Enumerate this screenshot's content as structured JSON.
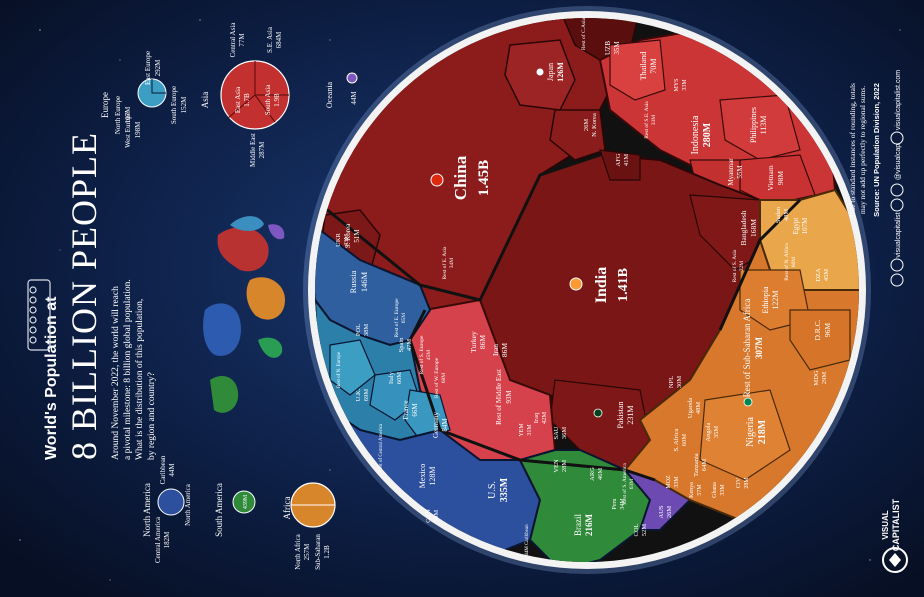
{
  "title": {
    "line1": "World's Population at",
    "line2": "8 BILLION PEOPLE",
    "intro1": "Around November 2022, the world will reach",
    "intro2": "a pivotal milestone: 8 billion global population.",
    "intro3": "What is the distribution of this population,",
    "intro4": "by region and country?"
  },
  "footer": {
    "note1": "Due to standard instances of rounding, totals",
    "note2": "may not add up perfectly to regional sums.",
    "source": "Source: UN Population Division, 2022",
    "brand1": "VISUAL",
    "brand2": "CAPITALIST",
    "social1": "visualcapitalist",
    "social2": "@visualcap",
    "social3": "visualcapitalist.com"
  },
  "legend": {
    "europe": {
      "label": "Europe",
      "north": "North Europe",
      "north_v": "107M",
      "east": "East Europe",
      "east_v": "292M",
      "west": "West Europe",
      "west_v": "198M",
      "south": "South Europe",
      "south_v": "152M"
    },
    "asia": {
      "label": "Asia",
      "central": "Central Asia",
      "central_v": "77M",
      "se": "S.E. Asia",
      "se_v": "684M",
      "east": "East Asia",
      "east_v": "1.7B",
      "south": "South Asia",
      "south_v": "1.9B",
      "middle": "Middle East",
      "middle_v": "287M"
    },
    "oceania": {
      "label": "Oceania",
      "value": "44M"
    },
    "namerica": {
      "label": "North America",
      "central": "Central America",
      "central_v": "182M",
      "carib": "Caribbean",
      "carib_v": "44M",
      "north": "North America",
      "north_v": "377M"
    },
    "samerica": {
      "label": "South America",
      "value": "439M"
    },
    "africa": {
      "label": "Africa",
      "north": "North Africa",
      "north_v": "257M",
      "sub": "Sub-Saharan",
      "sub_v": "1.2B"
    }
  },
  "cells": {
    "china": {
      "name": "China",
      "value": "1.45B"
    },
    "india": {
      "name": "India",
      "value": "1.41B"
    },
    "japan": {
      "name": "Japan",
      "value": "126M"
    },
    "skorea": {
      "name": "S. Korea",
      "value": "51M"
    },
    "nkorea": {
      "name": "N. Korea",
      "value": "26M"
    },
    "resteasia": {
      "name": "Rest of E. Asia",
      "value": "34M"
    },
    "uzb": {
      "name": "UZB",
      "value": "35M"
    },
    "restcasia": {
      "name": "Rest of C.Asia",
      "value": ""
    },
    "thailand": {
      "name": "Thailand",
      "value": "70M"
    },
    "mys": {
      "name": "MYS",
      "value": "33M"
    },
    "restseasia": {
      "name": "Rest of S.E. Asia",
      "value": "33M"
    },
    "indonesia": {
      "name": "Indonesia",
      "value": "280M"
    },
    "philippines": {
      "name": "Philippines",
      "value": "113M"
    },
    "myanmar": {
      "name": "Myanmar",
      "value": "55M"
    },
    "vietnam": {
      "name": "Vietnam",
      "value": "98M"
    },
    "afg": {
      "name": "AFG",
      "value": "41M"
    },
    "bangladesh": {
      "name": "Bangladesh",
      "value": "168M"
    },
    "restsasia": {
      "name": "Rest of S. Asia",
      "value": "22M"
    },
    "pakistan": {
      "name": "Pakistan",
      "value": "231M"
    },
    "npl": {
      "name": "NPL",
      "value": "30M"
    },
    "turkey": {
      "name": "Turkey",
      "value": "86M"
    },
    "iran": {
      "name": "Iran",
      "value": "86M"
    },
    "restme": {
      "name": "Rest of Middle East",
      "value": "93M"
    },
    "iraq": {
      "name": "Iraq",
      "value": "42M"
    },
    "sau": {
      "name": "SAU",
      "value": "36M"
    },
    "yem": {
      "name": "YEM",
      "value": "31M"
    },
    "russia": {
      "name": "Russia",
      "value": "146M"
    },
    "ukr": {
      "name": "UKR",
      "value": "43M"
    },
    "pol": {
      "name": "POL",
      "value": "38M"
    },
    "resteeurope": {
      "name": "Rest of E. Europe",
      "value": "65M"
    },
    "spain": {
      "name": "Spain",
      "value": "47M"
    },
    "restseurope": {
      "name": "Rest of S. Europe",
      "value": "45M"
    },
    "italy": {
      "name": "Italy",
      "value": "60M"
    },
    "uk": {
      "name": "U.K.",
      "value": "69M"
    },
    "restneurope": {
      "name": "Rest of N. Europe",
      "value": ""
    },
    "restweurope": {
      "name": "Rest of W. Europe",
      "value": "68M"
    },
    "france": {
      "name": "France",
      "value": "66M"
    },
    "germany": {
      "name": "Germany",
      "value": "84M"
    },
    "egypt": {
      "name": "Egypt",
      "value": "107M"
    },
    "sudan": {
      "name": "Sudan",
      "value": "48M"
    },
    "restnafrica": {
      "name": "Rest of N. Africa",
      "value": "60M"
    },
    "dza": {
      "name": "DZA",
      "value": "45M"
    },
    "ethiopia": {
      "name": "Ethiopia",
      "value": "122M"
    },
    "drc": {
      "name": "D.R.C.",
      "value": "96M"
    },
    "restssa": {
      "name": "Rest of Sub-Saharan Africa",
      "value": "307M"
    },
    "nigeria": {
      "name": "Nigeria",
      "value": "218M"
    },
    "moz": {
      "name": "MOZ",
      "value": "33M"
    },
    "uganda": {
      "name": "Uganda",
      "value": "48M"
    },
    "angola": {
      "name": "Angola",
      "value": "35M"
    },
    "safrica": {
      "name": "S. Africa",
      "value": "60M"
    },
    "tanzania": {
      "name": "Tanzania",
      "value": "64M"
    },
    "kenya": {
      "name": "Kenya",
      "value": "57M"
    },
    "ghana": {
      "name": "Ghana",
      "value": "33M"
    },
    "civ": {
      "name": "CIV",
      "value": "28M"
    },
    "mdg": {
      "name": "MDG",
      "value": "29M"
    },
    "aus": {
      "name": "AUS",
      "value": "26M"
    },
    "brazil": {
      "name": "Brazil",
      "value": "216M"
    },
    "arg": {
      "name": "ARG",
      "value": "46M"
    },
    "ven": {
      "name": "VEN",
      "value": "28M"
    },
    "col": {
      "name": "COL",
      "value": "52M"
    },
    "peru": {
      "name": "Peru",
      "value": "34M"
    },
    "restsamerica": {
      "name": "Rest of S. America",
      "value": "63M"
    },
    "us": {
      "name": "U.S.",
      "value": "335M"
    },
    "mexico": {
      "name": "Mexico",
      "value": "128M"
    },
    "can": {
      "name": "CAN",
      "value": "39M"
    },
    "restcamerica": {
      "name": "Rest of Central America",
      "value": ""
    },
    "restcarib": {
      "name": "44M Caribbean",
      "value": ""
    }
  },
  "colors": {
    "background": "#0a1530",
    "east_asia": "#8c1c1c",
    "south_asia": "#7a1616",
    "se_asia": "#cc3535",
    "middle_east": "#d6424c",
    "east_europe": "#2f5f9e",
    "europe": "#2b7fa8",
    "europe_light": "#3d9ec4",
    "africa": "#d8782c",
    "north_africa": "#e9a64a",
    "south_america": "#2f8a3a",
    "north_america": "#2c4f9e",
    "oceania": "#6c4ab2"
  }
}
